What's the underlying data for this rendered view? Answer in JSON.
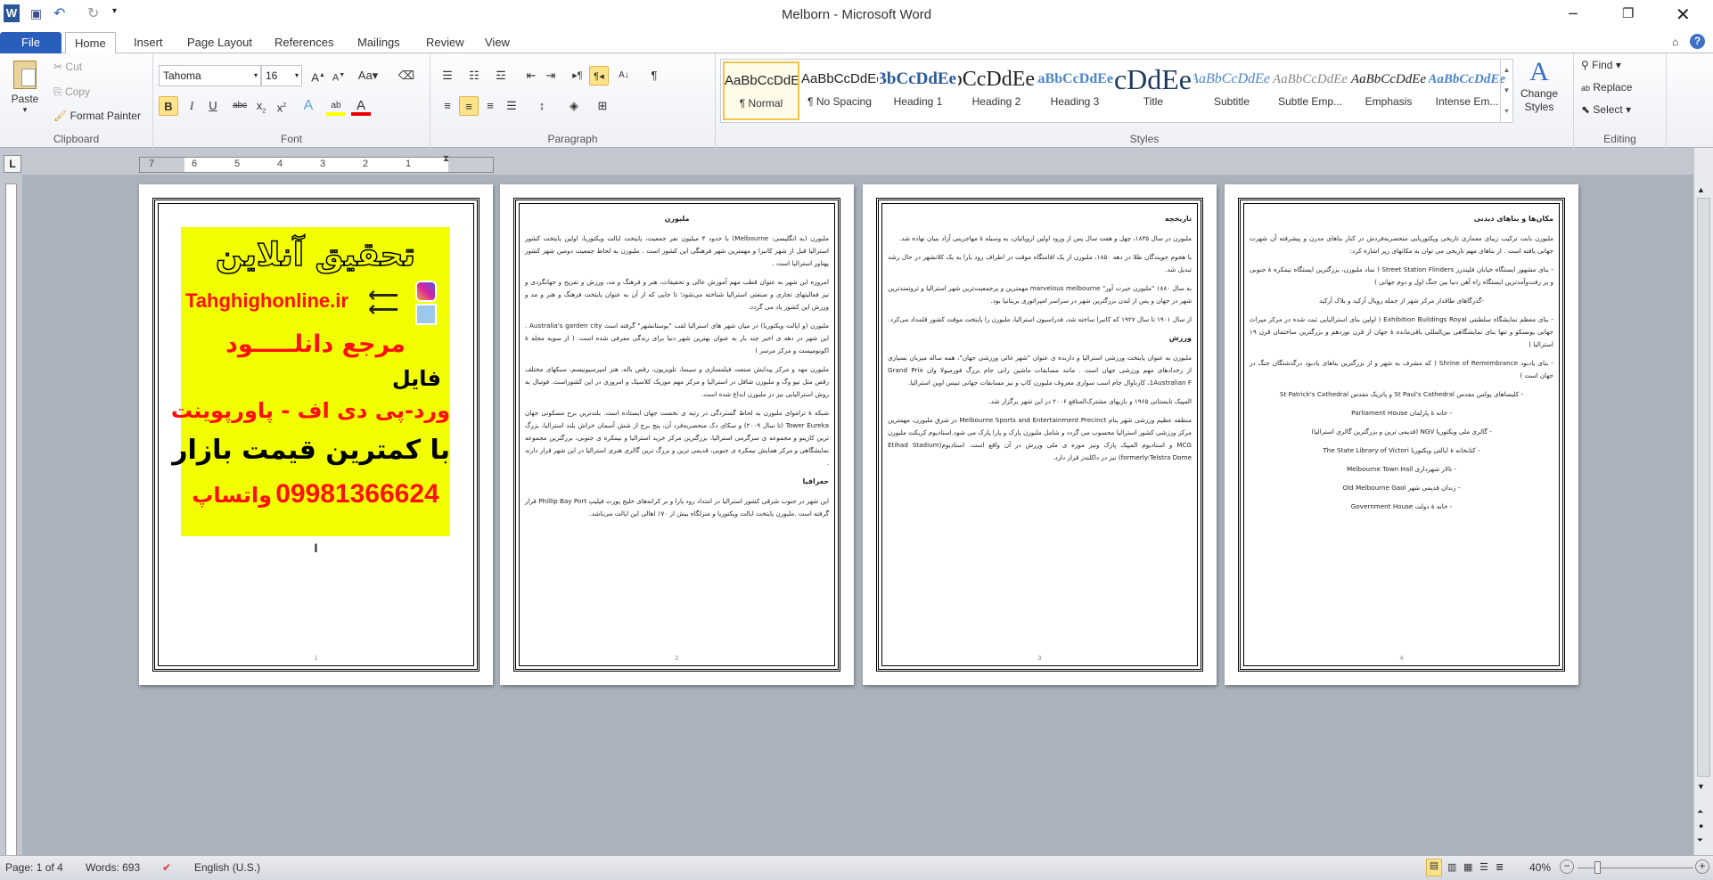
{
  "window": {
    "title": "Melborn - Microsoft Word"
  },
  "quick_access": {
    "icons": [
      "word-logo-icon",
      "save-icon",
      "undo-icon",
      "redo-icon",
      "customize-icon"
    ]
  },
  "tabs": [
    {
      "label": "File"
    },
    {
      "label": "Home",
      "active": true
    },
    {
      "label": "Insert"
    },
    {
      "label": "Page Layout"
    },
    {
      "label": "References"
    },
    {
      "label": "Mailings"
    },
    {
      "label": "Review"
    },
    {
      "label": "View"
    }
  ],
  "ribbon": {
    "clipboard": {
      "label": "Clipboard",
      "paste": "Paste",
      "cut": "Cut",
      "copy": "Copy",
      "format_painter": "Format Painter"
    },
    "font": {
      "label": "Font",
      "font_name": "Tahoma",
      "font_size": "16",
      "bold_active": true
    },
    "paragraph": {
      "label": "Paragraph",
      "align": "center",
      "rtl_active": true
    },
    "styles": {
      "label": "Styles",
      "change_styles": "Change Styles",
      "items": [
        {
          "preview": "AaBbCcDdEe",
          "name": "¶ Normal",
          "selected": true
        },
        {
          "preview": "AaBbCcDdEe",
          "name": "¶ No Spacing"
        },
        {
          "preview": "AaBbCcDdEe",
          "name": "Heading 1"
        },
        {
          "preview": "AaBbCcDdEe",
          "name": "Heading 2"
        },
        {
          "preview": "AaBbCcDdEe",
          "name": "Heading 3"
        },
        {
          "preview": "AaBbCcDdEe",
          "name": "Title"
        },
        {
          "preview": "AaBbCcDdEe",
          "name": "Subtitle"
        },
        {
          "preview": "AaBbCcDdEe",
          "name": "Subtle Emp..."
        },
        {
          "preview": "AaBbCcDdEe",
          "name": "Emphasis"
        },
        {
          "preview": "AaBbCcDdEe",
          "name": "Intense Em..."
        }
      ]
    },
    "editing": {
      "label": "Editing",
      "find": "Find",
      "replace": "Replace",
      "select": "Select"
    }
  },
  "ruler": {
    "ticks": [
      "7",
      "6",
      "5",
      "4",
      "3",
      "2",
      "1"
    ]
  },
  "pages": {
    "p1": {
      "banner_title": "تحقیق آنلاین",
      "site": "Tahghighonline.ir",
      "line1": "مرجع دانلـــــود",
      "line2": "فایل",
      "line3": "ورد-پی دی اف - پاورپوینت",
      "line4": "با کمترین قیمت بازار",
      "phone": "09981366624",
      "whatsapp": "واتساپ",
      "cursor": "I",
      "num": "1"
    },
    "p2": {
      "title": "ملبورن",
      "paras": [
        "ملبورن (به انگلیسی: Melbourne) با حدود ۴ میلیون نفر جمعیت، پایتخت ایالت ویکتوریا، اولین پایتخت کشور استرالیا قبل از شهر کانبرا و مهمترین شهر فرهنگی این کشور است . ملبورن به لحاظ جمعیت دومین شهر کشور پهناور استرالیا است .",
        "امروزه این شهر به عنوان قطب مهم آموزش عالی و تحقیقات، هنر و فرهنگ و مد، ورزش و تفریح و جهانگردی و نیز فعالیتهای تجاری و صنعتی استرالیا شناخته می‌شود؛ تا جایی که از آن به عنوان پایتخت فرهنگ و هنر و مد و ورزش این کشور یاد می گردد.",
        "ملبورن (و ایالت ویکتوریا) در میان شهر های استرالیا لقب \"بوستانشهر\" گرفته است Australia's garden city . این شهر در دهه ی اخیر چند بار به عنوان بهترین شهر دنیا برای زندگی معرفی شده است. ( از سویه مجله ۀ اکونومیست و مرکز مرسر )",
        "ملبورن مهد و مرکز پیدایش صنعت فیلمسازی و سینما، تلویزیون، رقص باله، هنر امپرسیونیسم، سبکهای مختلف رقص مثل نیو وگ و ملبورن شافل در استرالیا و مرکز مهم موزیک کلاسیک و امروزی در این کشوراست. فوتبال به روش استرالیایی نیز در ملبورن ابداع شده است.",
        "شبکه ۀ تراموای ملبورن به لحاظ گستردگی در رتبه ی نخست جهان ایستاده است. بلندترین برج مسکونی جهان Tower Eureka (تا سال ۲۰۰۹) و سکای دک منحصربه‌فرد آن، پنج برج از شش آسمان خراش بلند استرالیا، بزرگ ترین کازینو و مجموعه ی سرگرمی استرالیا، بزرگترین مرکز خرید استرالیا و نیمکره ی جنوبی، بزرگترین مجموعه نمایشگاهی و مرکز همایش نیمکره ی جنوبی، قدیمی ترین و بزرگ ترین گالری هنری استرالیا در این شهر قرار دارند ."
      ],
      "heading2": "جغرافیا",
      "geo": "این شهر در جنوب شرقی کشور استرالیا در امتداد رود یارا و بر کرانه‌های خلیج پورت فیلیپ Phillip Bay Port قرار گرفته است .ملبورن پایتخت ایالت ویکتوریا و منزلگاه بیش از ۷۰٪ اهالی این ایالت می‌باشد.",
      "num": "2"
    },
    "p3": {
      "heading1": "تاریخچه",
      "history": [
        "ملبورن در سال ۱۸۳۵، چهل و هفت سال پس از ورود اولین اروپائیان، به وسیله ۀ مهاجرینی آزاد بنیان نهاده شد.",
        "با هجوم جویندگان طلا در دهه ۱۸۵۰، ملبورن از یک اقامتگاه موقت در اطراف رود یارا به یک کلانشهر در حال رشد تبدیل شد.",
        "به سال ۱۸۸۰ \"ملبورن حیرت آور\" marvelous melbourne مهمترین و پرجمعیت‌ترین شهر استرالیا و ثروتمندترین شهر در جهان و پس از لندن بزرگترین شهر در سراسر امپراتوری بریتانیا بود.",
        "از سال ۱۹۰۱ تا سال ۱۹۲۷ که کانبرا ساخته شد، فدراسیون استرالیا، ملبورن را پایتخت موقت کشور قلمداد می‌کرد."
      ],
      "heading2": "ورزش",
      "sport": [
        "ملبورن به عنوان پایتخت ورزشی استرالیا و دارنده ی عنوان \"شهر غائی ورزشی جهان\"، همه ساله میزبان بسیاری از رخدادهای مهم ورزشی جهان است . مانند مسابقات ماشین رانی جام بزرگ فورمیولا وان Grand Prix 1Australian F، کارناوال جام اسب سواری معروف ملبورن کاپ و نیز مسابقات جهانی تنیس اوپن استرالیا.",
        "المپیک تابستانی ۱۹۶۵ و بازیهای مشترک‌المنافع ۲۰۰۶ در این شهر برگزار شد.",
        "منطقه عظیم ورزشی شهر بنام Melbourne Sports and Entertainment Precinct در شرق ملبورن، مهمترین مرکز ورزشی کشور استرالیا محسوب می گردد و شامل ملبورن پارک و یارا پارک می شود.استادیوم کریکت ملبورن MCG و استادیوم المپیک پارک ونیز موزه ی ملی ورزش در آن واقع است. استادیوم(Etihad Stadium formerly:Telstra Dome) نیز در داکلندز قرار دارد."
      ],
      "num": "3"
    },
    "p4": {
      "heading": "مکان‌ها و بناهای دیدنی",
      "intro": "ملبورن بابت ترکیب زیبای معماری تاریخی ویکتوریایی منحصربه‌فردش در کنار بناهای مدرن و پیشرفته آن شهرت جهانی یافته است . از بناهای مهم تاریخی می توان به مکانهای زیر اشاره کرد:",
      "items": [
        "- بنای مشهور ایستگاه خیابان فلیندرز Street Station Flinders ( نماد ملبورن، بزرگترین ایستگاه نیمکره ۀ جنوبی و پر رفت‌وآمدترین ایستگاه راه آهن دنیا بین جنگ اول و دوم جهانی )",
        "-گذرگاهای طاقدار مرکز شهر از جمله رویال آرکید و بلاک آرکید",
        "- بنای معظم نمایشگاه سلطنتی Exhibition Buildings Royal ( اولین بنای استرالیایی ثبت شده در مرکز میراث جهانی یونسکو و تنها بنای نمایشگاهی بین‌المللی باقی‌مانده ۀ جهان از قرن نوزدهم و بزرگترین ساختمان قرن ۱۹ استرالیا )",
        "- بنای یادبود Shrine of Remembrance ( که مشرف به شهر و از بزرگترین بناهای یادبود درگذشتگان جنگ در جهان است )",
        "- کلیساهای پولس مقدس St Paul's Cathedral و پاتریک مقدس St Patrick's Cathedral",
        "- خانه ۀ پارلمان Parliament House",
        "- گالری ملی ویکتوریا NGV (قدیمی ترین و بزرگترین گالری استرالیا)",
        "- کتابخانه ۀ ایالتی ویکتوریا The State Library of Victori",
        "- تالار شهرداری Melbourne Town Hall",
        "- زندان قدیمی شهر Old Melbourne Gaol",
        "- خانه ۀ دولت Government House"
      ],
      "num": "4"
    }
  },
  "status": {
    "page": "Page: 1 of 4",
    "words": "Words: 693",
    "language": "English (U.S.)",
    "zoom": "40%",
    "zoom_value": 40
  },
  "colors": {
    "file_tab": "#2a5ebc",
    "highlight": "#fde48a",
    "banner_bg": "#f2ff00",
    "banner_red": "#ff1010"
  }
}
